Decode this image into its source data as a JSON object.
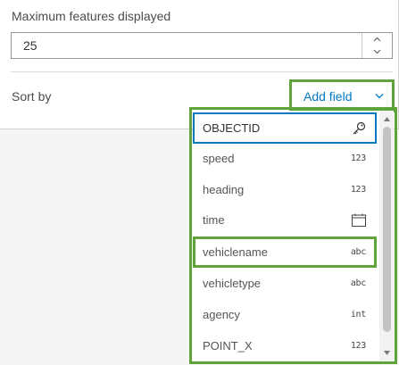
{
  "max_features": {
    "label": "Maximum features displayed",
    "value": "25"
  },
  "sort": {
    "label": "Sort by",
    "add_field_label": "Add field"
  },
  "fields": [
    {
      "name": "OBJECTID",
      "type_label": "",
      "icon": "key-icon"
    },
    {
      "name": "speed",
      "type_label": "123",
      "icon": "number-type-icon"
    },
    {
      "name": "heading",
      "type_label": "123",
      "icon": "number-type-icon"
    },
    {
      "name": "time",
      "type_label": "",
      "icon": "calendar-icon"
    },
    {
      "name": "vehiclename",
      "type_label": "abc",
      "icon": "string-type-icon"
    },
    {
      "name": "vehicletype",
      "type_label": "abc",
      "icon": "string-type-icon"
    },
    {
      "name": "agency",
      "type_label": "int",
      "icon": "integer-type-icon"
    },
    {
      "name": "POINT_X",
      "type_label": "123",
      "icon": "number-type-icon"
    }
  ],
  "colors": {
    "accent": "#0079c1",
    "highlight": "#5fa33b"
  }
}
